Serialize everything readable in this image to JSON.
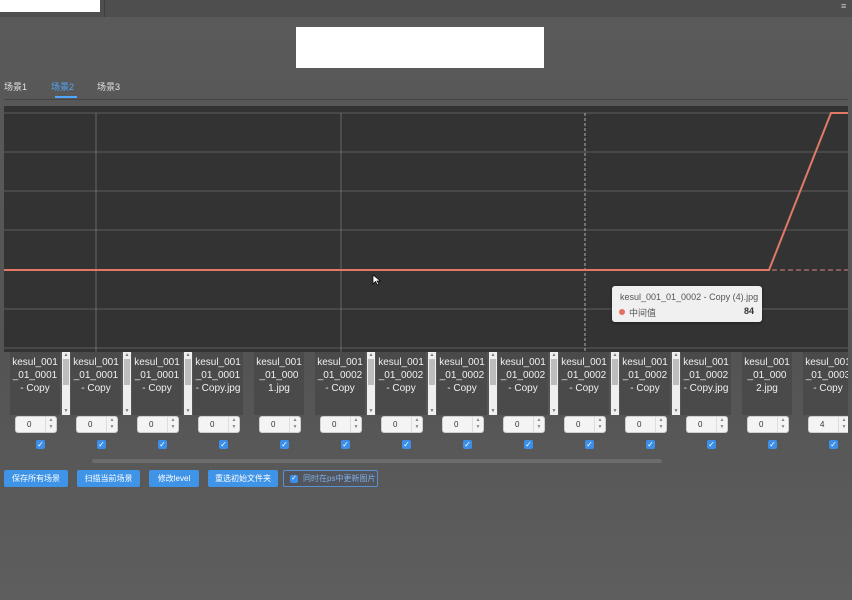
{
  "tabs": [
    "场景1",
    "场景2",
    "场景3"
  ],
  "active_tab": 1,
  "chart_data": {
    "type": "line",
    "series": [
      {
        "name": "中间值"
      }
    ],
    "line_color": "#e07a66"
  },
  "tooltip": {
    "title": "kesul_001_01_0002 - Copy (4).jpg",
    "series_name": "中间值",
    "value": "84"
  },
  "columns": [
    {
      "name": "kesul_001_01_0001 - Copy",
      "value": "0"
    },
    {
      "name": "kesul_001_01_0001 - Copy",
      "value": "0"
    },
    {
      "name": "kesul_001_01_0001 - Copy",
      "value": "0"
    },
    {
      "name": "kesul_001_01_0001 - Copy.jpg",
      "value": "0"
    },
    {
      "name": "kesul_001_01_0001.jpg",
      "value": "0"
    },
    {
      "name": "kesul_001_01_0002 - Copy",
      "value": "0"
    },
    {
      "name": "kesul_001_01_0002 - Copy",
      "value": "0"
    },
    {
      "name": "kesul_001_01_0002 - Copy",
      "value": "0"
    },
    {
      "name": "kesul_001_01_0002 - Copy",
      "value": "0"
    },
    {
      "name": "kesul_001_01_0002 - Copy",
      "value": "0"
    },
    {
      "name": "kesul_001_01_0002 - Copy",
      "value": "0"
    },
    {
      "name": "kesul_001_01_0002 - Copy.jpg",
      "value": "0"
    },
    {
      "name": "kesul_001_01_0002.jpg",
      "value": "0"
    },
    {
      "name": "kesul_001_01_0003 - Copy",
      "value": "4"
    }
  ],
  "buttons": [
    "保存所有场景",
    "扫描当前场景",
    "修改level",
    "重选初始文件夹"
  ],
  "sync_checkbox_label": "同时在ps中更新图片",
  "accent_color": "#3f94e8"
}
